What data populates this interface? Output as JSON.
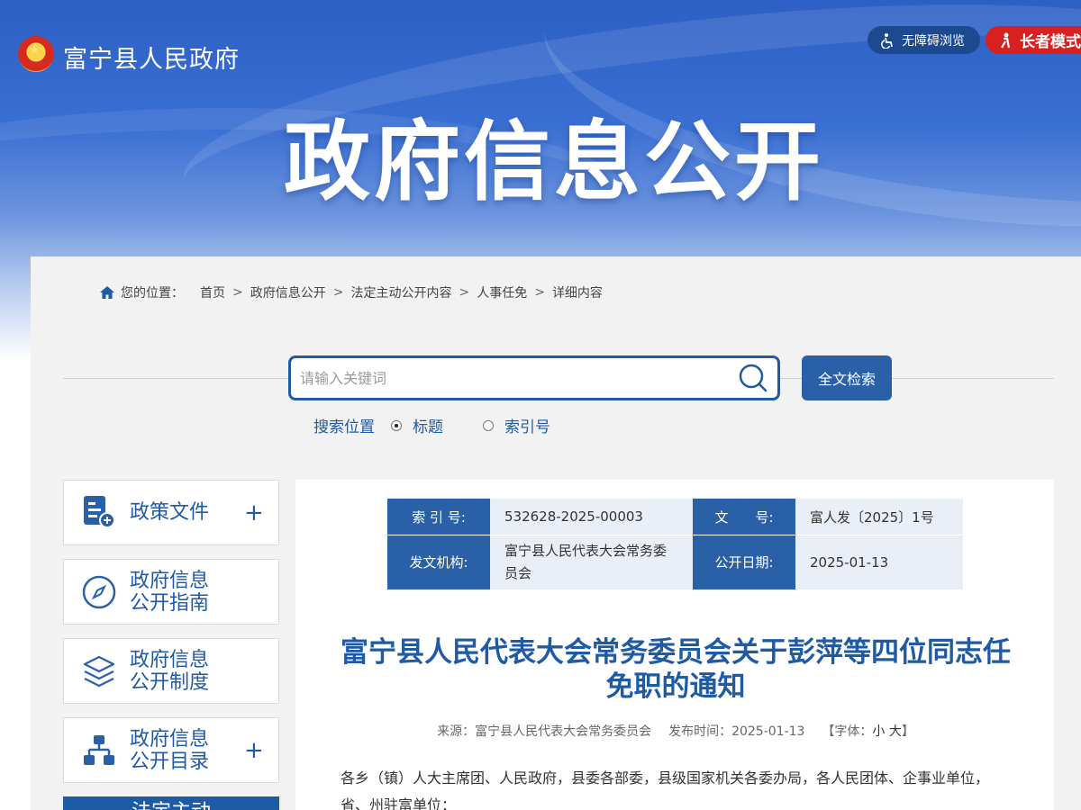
{
  "header": {
    "site_name": "富宁县人民政府",
    "accessibility_label": "无障碍浏览",
    "elder_mode_label": "长者模式",
    "banner_title": "政府信息公开"
  },
  "breadcrumb": {
    "prefix": "您的位置：",
    "items": [
      "首页",
      "政府信息公开",
      "法定主动公开内容",
      "人事任免",
      "详细内容"
    ]
  },
  "search": {
    "placeholder": "请输入关键词",
    "button_label": "全文检索",
    "scope_label": "搜索位置",
    "options": [
      "标题",
      "索引号"
    ],
    "selected": "标题"
  },
  "sidebar": {
    "items": [
      {
        "label_line1": "政策文件",
        "label_line2": "",
        "expandable": true,
        "icon": "document-plus-icon"
      },
      {
        "label_line1": "政府信息",
        "label_line2": "公开指南",
        "expandable": false,
        "icon": "compass-icon"
      },
      {
        "label_line1": "政府信息",
        "label_line2": "公开制度",
        "expandable": false,
        "icon": "layers-icon"
      },
      {
        "label_line1": "政府信息",
        "label_line2": "公开目录",
        "expandable": true,
        "icon": "sitemap-icon"
      }
    ],
    "active_item_label": "法定主动"
  },
  "meta_table": {
    "index_key": "索 引 号:",
    "index_value": "532628-2025-00003",
    "docno_key": "文　　号:",
    "docno_value": "富人发〔2025〕1号",
    "issuer_key": "发文机构:",
    "issuer_value": "富宁县人民代表大会常务委员会",
    "date_key": "公开日期:",
    "date_value": "2025-01-13"
  },
  "article": {
    "title": "富宁县人民代表大会常务委员会关于彭萍等四位同志任免职的通知",
    "source_label": "来源：",
    "source": "富宁县人民代表大会常务委员会",
    "publish_label": "发布时间：",
    "publish_date": "2025-01-13",
    "font_label": "【字体：",
    "font_small": "小",
    "font_large": "大",
    "font_end": "】",
    "body_line1": "各乡（镇）人大主席团、人民政府，县委各部委，县级国家机关各委办局，各人民团体、企事业单位，",
    "body_line2": "省、州驻富单位："
  },
  "colors": {
    "brand_blue": "#1f5aa5",
    "elder_red": "#d8201f",
    "table_key_bg": "#2a60a8",
    "table_value_bg": "#e9eef7"
  }
}
